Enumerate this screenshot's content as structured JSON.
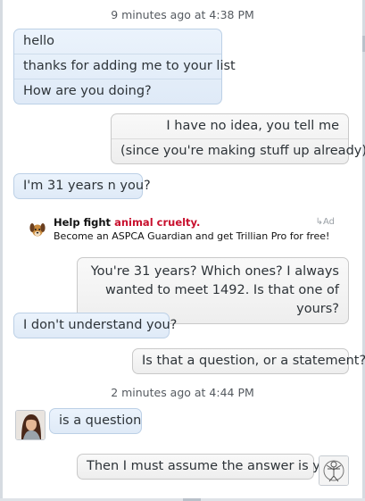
{
  "conversation": {
    "timestamp_1": "9 minutes ago at 4:38 PM",
    "timestamp_2": "2 minutes ago at 4:44 PM",
    "messages": [
      {
        "direction": "incoming",
        "lines": [
          "hello",
          "thanks for adding me to your list",
          "How are you doing?"
        ]
      },
      {
        "direction": "outgoing",
        "lines": [
          "I have no idea, you tell me",
          "(since you're making stuff up already)"
        ]
      },
      {
        "direction": "incoming",
        "lines": [
          "I'm 31 years n you?"
        ]
      },
      {
        "direction": "outgoing",
        "lines": [
          "You're 31 years?  Which ones?  I always wanted to meet 1492.  Is that one of yours?"
        ]
      },
      {
        "direction": "incoming",
        "lines": [
          "I don't understand you?"
        ]
      },
      {
        "direction": "outgoing",
        "lines": [
          "Is that a question, or a statement?"
        ]
      },
      {
        "direction": "incoming",
        "lines": [
          "is a question"
        ]
      },
      {
        "direction": "outgoing",
        "lines": [
          "Then I must assume the answer is yes."
        ]
      }
    ]
  },
  "ad": {
    "title_prefix": "Help fight",
    "title_highlight": "animal cruelty.",
    "subtitle": "Become an ASPCA Guardian and get Trillian Pro for free!",
    "tag": "Ad",
    "icon": "dog-icon",
    "highlight_color": "#c8102e"
  },
  "avatars": {
    "contact": "contact-avatar",
    "self": "self-avatar"
  },
  "colors": {
    "incoming_bubble": "#e4eef9",
    "outgoing_bubble": "#f3f3f3",
    "timestamp_text": "#555a60"
  }
}
